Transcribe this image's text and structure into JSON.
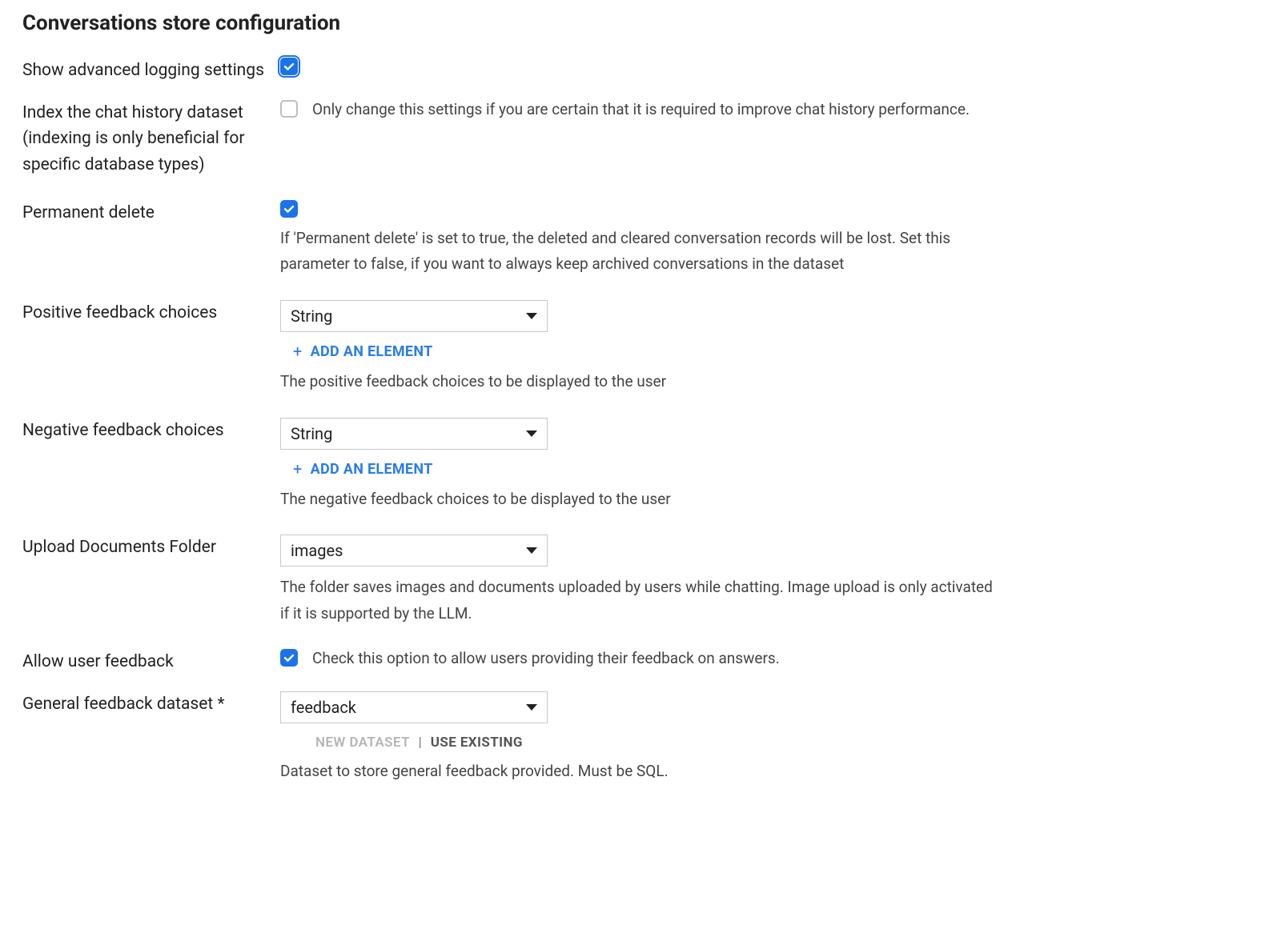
{
  "section": {
    "title": "Conversations store configuration"
  },
  "fields": {
    "show_advanced": {
      "label": "Show advanced logging settings",
      "checked": true
    },
    "index_history": {
      "label": "Index the chat history dataset (indexing is only beneficial for specific database types)",
      "checked": false,
      "hint": "Only change this settings if you are certain that it is required to improve chat history performance."
    },
    "permanent_delete": {
      "label": "Permanent delete",
      "checked": true,
      "help": "If 'Permanent delete' is set to true, the deleted and cleared conversation records will be lost. Set this parameter to false, if you want to always keep archived conversations in the dataset"
    },
    "positive_feedback": {
      "label": "Positive feedback choices",
      "value": "String",
      "add_label": "ADD AN ELEMENT",
      "help": "The positive feedback choices to be displayed to the user"
    },
    "negative_feedback": {
      "label": "Negative feedback choices",
      "value": "String",
      "add_label": "ADD AN ELEMENT",
      "help": "The negative feedback choices to be displayed to the user"
    },
    "upload_folder": {
      "label": "Upload Documents Folder",
      "value": "images",
      "help": "The folder saves images and documents uploaded by users while chatting. Image upload is only activated if it is supported by the LLM."
    },
    "allow_feedback": {
      "label": "Allow user feedback",
      "checked": true,
      "hint": "Check this option to allow users providing their feedback on answers."
    },
    "general_feedback": {
      "label": "General feedback dataset *",
      "value": "feedback",
      "segmented_new": "NEW DATASET",
      "segmented_existing": "USE EXISTING",
      "help": "Dataset to store general feedback provided. Must be SQL."
    }
  }
}
